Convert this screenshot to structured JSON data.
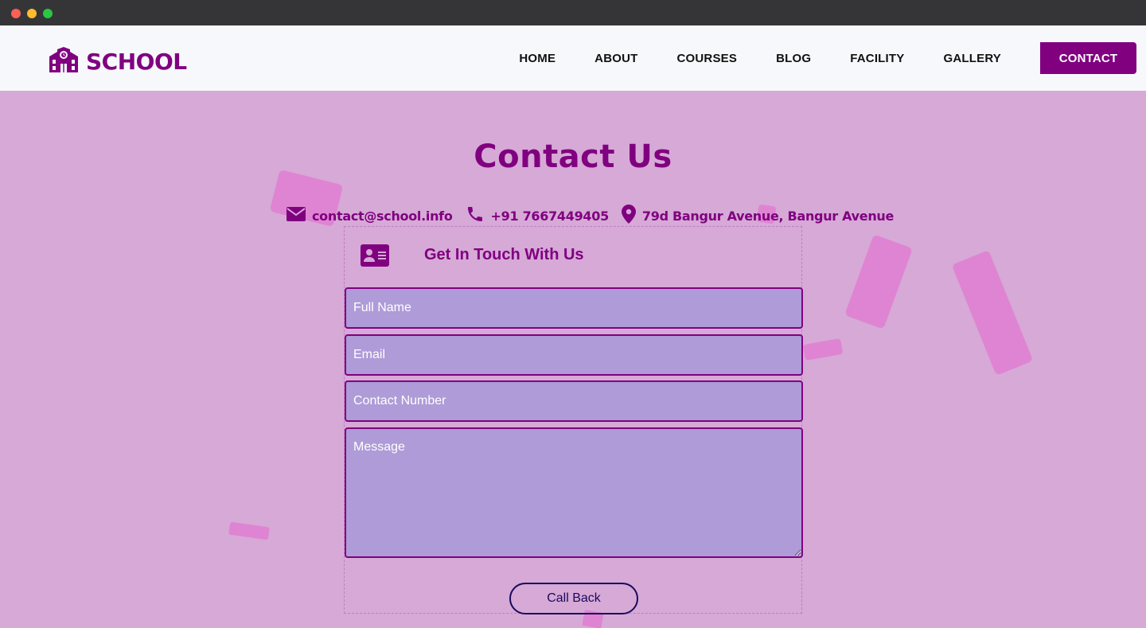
{
  "brand": {
    "name": "SCHOOL"
  },
  "nav": {
    "items": [
      {
        "label": "HOME"
      },
      {
        "label": "ABOUT"
      },
      {
        "label": "COURSES"
      },
      {
        "label": "BLOG"
      },
      {
        "label": "FACILITY"
      },
      {
        "label": "GALLERY"
      },
      {
        "label": "CONTACT",
        "active": true
      }
    ]
  },
  "page": {
    "title": "Contact Us"
  },
  "contact_info": {
    "email": "contact@school.info",
    "phone": "+91 7667449405",
    "address": "79d Bangur Avenue, Bangur Avenue"
  },
  "form": {
    "heading": "Get In Touch With Us",
    "fields": {
      "name_placeholder": "Full Name",
      "email_placeholder": "Email",
      "phone_placeholder": "Contact Number",
      "message_placeholder": "Message"
    },
    "submit_label": "Call Back"
  },
  "colors": {
    "brand": "#800080",
    "background": "#d6a9d6",
    "field_bg": "#ae9bd7",
    "shape": "#e07fd2"
  },
  "icons": [
    "school-building-icon",
    "envelope-icon",
    "phone-icon",
    "location-pin-icon",
    "contact-card-icon"
  ]
}
